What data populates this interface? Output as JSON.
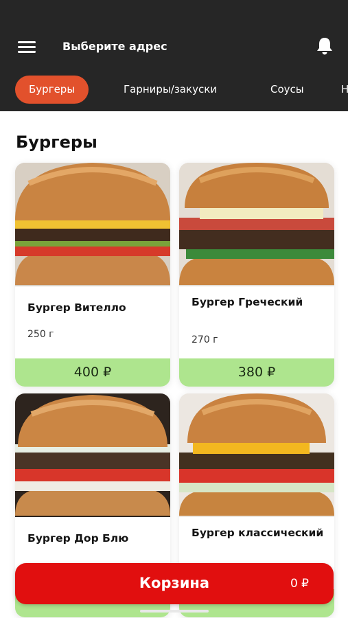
{
  "header": {
    "address_label": "Выберите адрес",
    "menu_icon": "hamburger-menu-icon",
    "bell_icon": "bell-icon"
  },
  "tabs": [
    {
      "label": "Бургеры",
      "active": true
    },
    {
      "label": "Гарниры/закуски",
      "active": false
    },
    {
      "label": "Соусы",
      "active": false
    },
    {
      "label": "Н",
      "active": false
    }
  ],
  "section": {
    "title": "Бургеры"
  },
  "products": [
    {
      "name": "Бургер Вителло",
      "weight": "250 г",
      "price": "400 ₽"
    },
    {
      "name": "Бургер Греческий",
      "weight": "270 г",
      "price": "380 ₽"
    },
    {
      "name": "Бургер Дор Блю",
      "weight": "",
      "price": ""
    },
    {
      "name": "Бургер классический",
      "weight": "",
      "price": ""
    }
  ],
  "cart": {
    "label": "Корзина",
    "total": "0 ₽"
  },
  "colors": {
    "header_bg": "#262626",
    "active_tab": "#e2512c",
    "price_bg": "#aee58e",
    "cart_bg": "#e10f0f"
  }
}
